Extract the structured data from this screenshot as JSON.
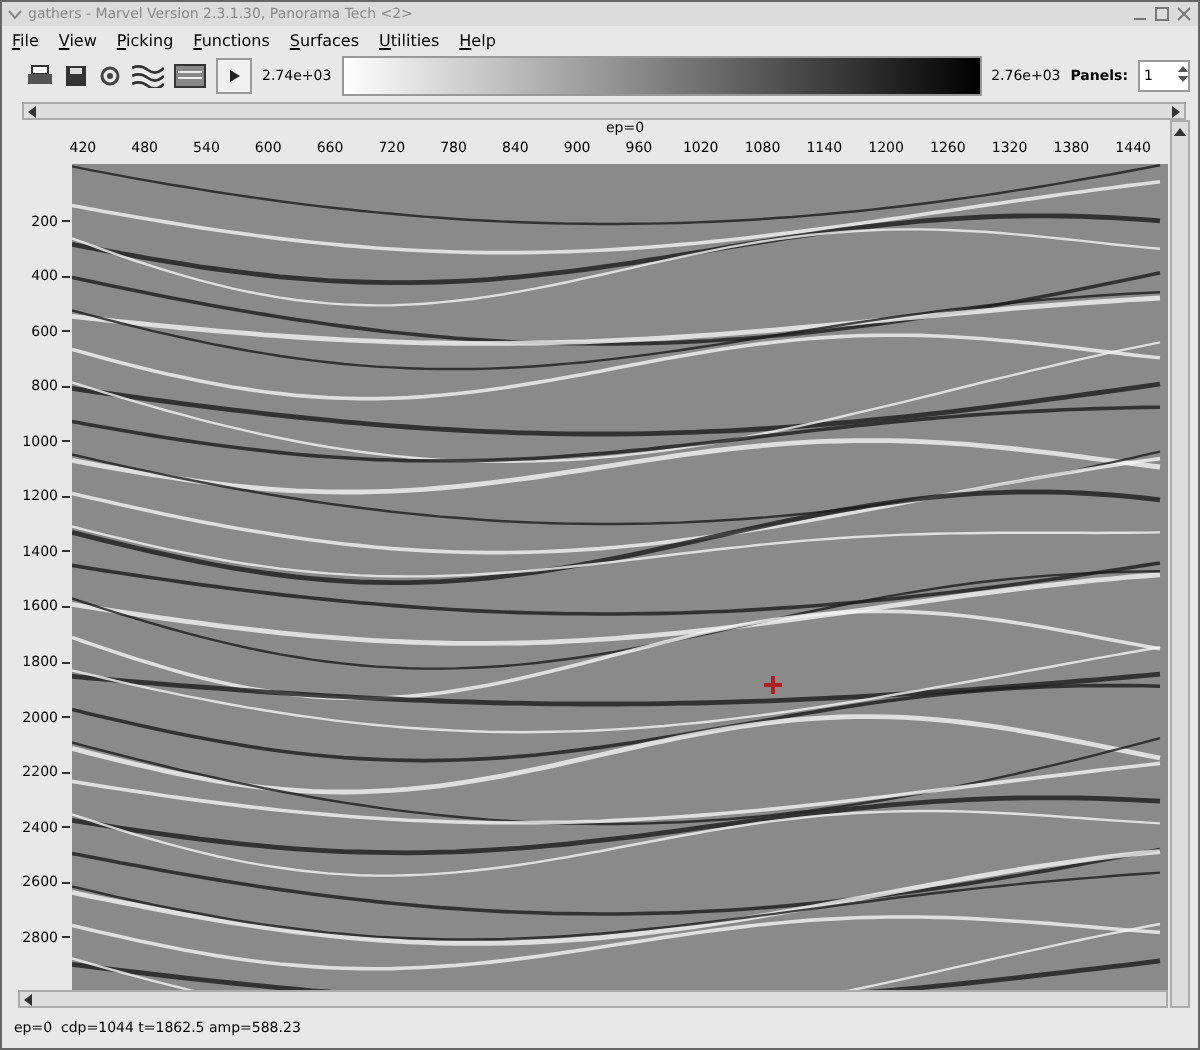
{
  "window": {
    "title": "gathers - Marvel Version 2.3.1.30, Panorama Tech <2>"
  },
  "menu": [
    "File",
    "View",
    "Picking",
    "Functions",
    "Surfaces",
    "Utilities",
    "Help"
  ],
  "toolbar": {
    "scale_min": "2.74e+03",
    "scale_max": "2.76e+03",
    "panels_label": "Panels:",
    "panels_value": "1"
  },
  "plot": {
    "top_label": "ep=0",
    "x_ticks": [
      "420",
      "480",
      "540",
      "600",
      "660",
      "720",
      "780",
      "840",
      "900",
      "960",
      "1020",
      "1080",
      "1140",
      "1200",
      "1260",
      "1320",
      "1380",
      "1440"
    ],
    "y_ticks": [
      "200",
      "400",
      "600",
      "800",
      "1000",
      "1200",
      "1400",
      "1600",
      "1800",
      "2000",
      "2200",
      "2400",
      "2600",
      "2800"
    ]
  },
  "status_bar": "ep=0  cdp=1044 t=1862.5 amp=588.23"
}
